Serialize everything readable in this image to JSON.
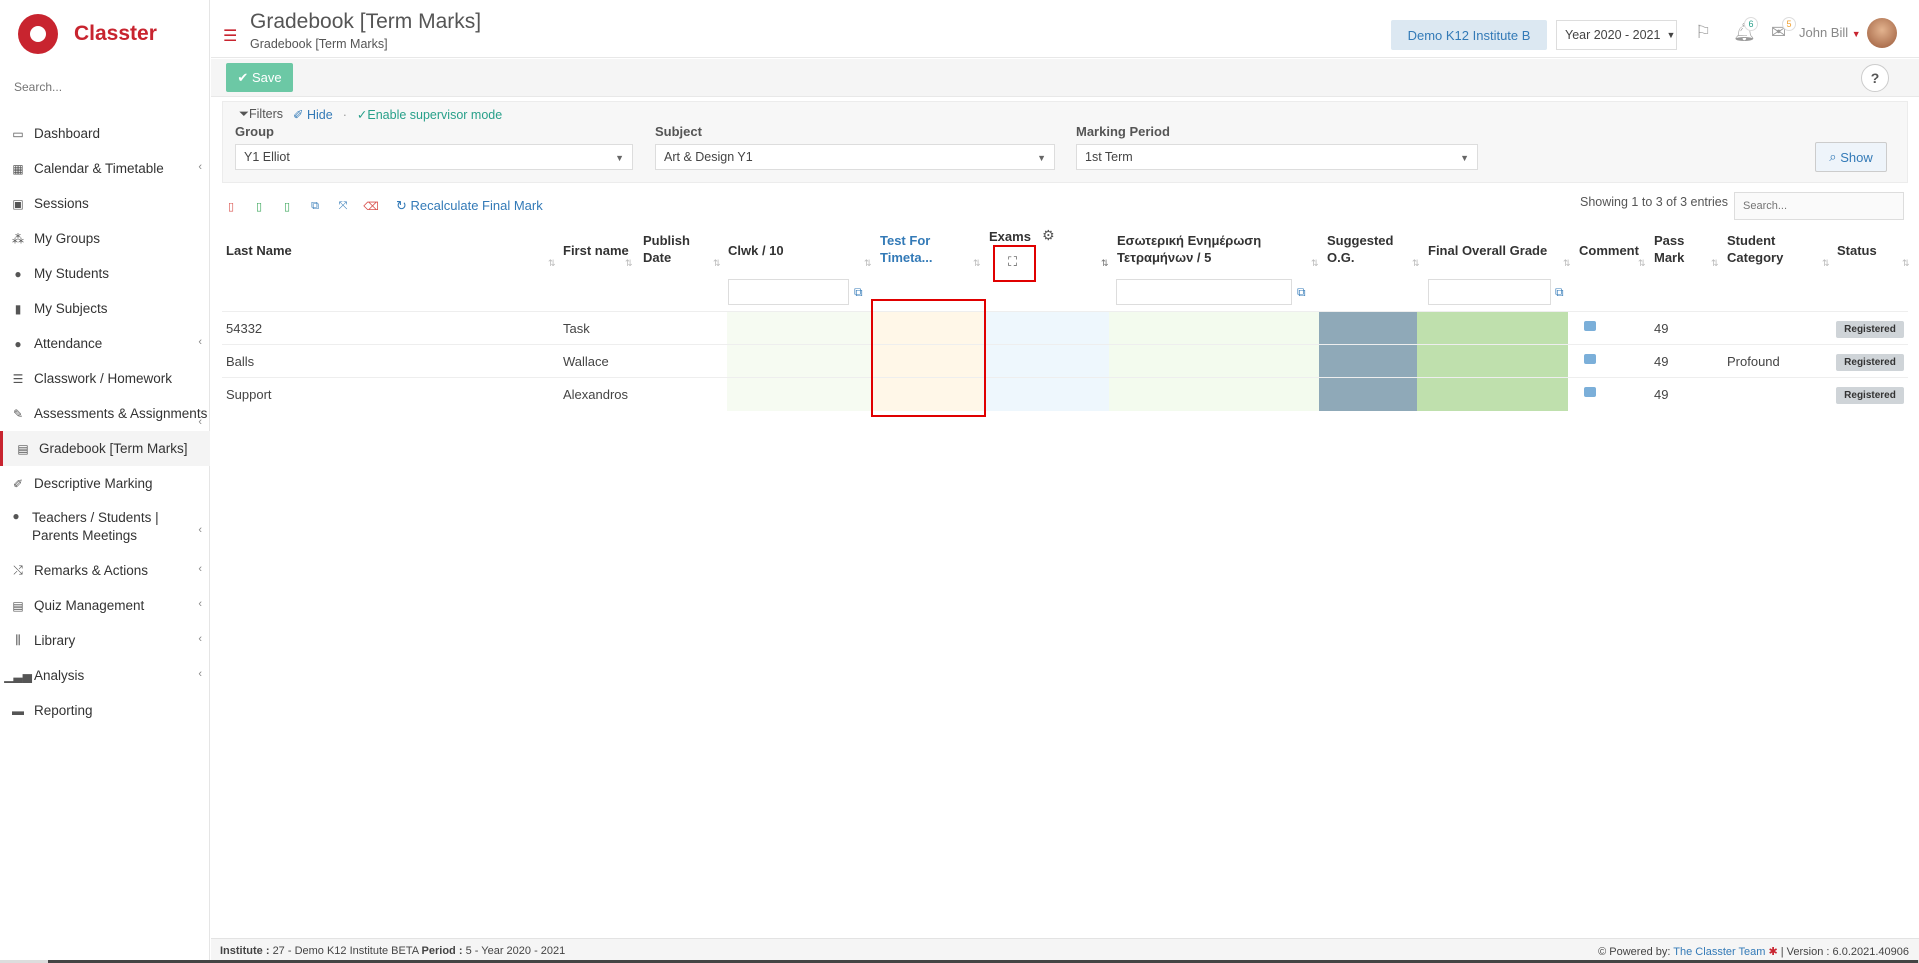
{
  "brand": {
    "name": "Classter"
  },
  "sidebar": {
    "search_placeholder": "Search...",
    "items": [
      {
        "label": "Dashboard"
      },
      {
        "label": "Calendar & Timetable"
      },
      {
        "label": "Sessions"
      },
      {
        "label": "My Groups"
      },
      {
        "label": "My Students"
      },
      {
        "label": "My Subjects"
      },
      {
        "label": "Attendance"
      },
      {
        "label": "Classwork / Homework"
      },
      {
        "label": "Assessments & Assignments"
      },
      {
        "label": "Gradebook [Term Marks]"
      },
      {
        "label": "Descriptive Marking"
      },
      {
        "label": "Teachers / Students | Parents Meetings"
      },
      {
        "label": "Remarks & Actions"
      },
      {
        "label": "Quiz Management"
      },
      {
        "label": "Library"
      },
      {
        "label": "Analysis"
      },
      {
        "label": "Reporting"
      }
    ]
  },
  "header": {
    "title": "Gradebook [Term Marks]",
    "subtitle": "Gradebook [Term Marks]",
    "institute": "Demo K12 Institute B",
    "year": "Year 2020 - 2021",
    "notifications_count": "6",
    "messages_count": "5",
    "user": "John Bill"
  },
  "actions": {
    "save": "Save",
    "help": "?"
  },
  "filters": {
    "filters_label": "Filters",
    "hide_label": "Hide",
    "supervisor_label": "Enable supervisor mode",
    "group_label": "Group",
    "group_value": "Y1 Elliot",
    "subject_label": "Subject",
    "subject_value": "Art & Design Y1",
    "period_label": "Marking Period",
    "period_value": "1st Term",
    "show": "Show"
  },
  "toolbar": {
    "recalc": "Recalculate Final Mark",
    "showing": "Showing 1 to 3 of 3 entries",
    "search_placeholder": "Search..."
  },
  "table": {
    "headers": {
      "last_name": "Last Name",
      "first_name": "First name",
      "publish_date": "Publish Date",
      "clwk": "Clwk / 10",
      "test": "Test For Timeta...",
      "exams": "Exams",
      "internal": "Εσωτερική Ενημέρωση Τετραμήνων / 5",
      "suggested": "Suggested O.G.",
      "final": "Final Overall Grade",
      "comment": "Comment",
      "pass_mark": "Pass Mark",
      "category": "Student Category",
      "status": "Status"
    },
    "rows": [
      {
        "last": "54332",
        "first": "Task",
        "pass": "49",
        "category": "",
        "status": "Registered"
      },
      {
        "last": "Balls",
        "first": "Wallace",
        "pass": "49",
        "category": "Profound",
        "status": "Registered"
      },
      {
        "last": "Support",
        "first": "Alexandros",
        "pass": "49",
        "category": "",
        "status": "Registered"
      }
    ]
  },
  "footer": {
    "institute_label": "Institute :",
    "institute_value": "27 - Demo K12 Institute BETA",
    "period_label": "Period :",
    "period_value": "5 - Year 2020 - 2021",
    "powered": "Powered by:",
    "team": "The Classter Team",
    "version": "| Version : 6.0.2021.40906"
  },
  "colors": {
    "brand": "#c8242f",
    "accent": "#337ab7",
    "save": "#6cc8a5",
    "highlight": "#e00000"
  }
}
